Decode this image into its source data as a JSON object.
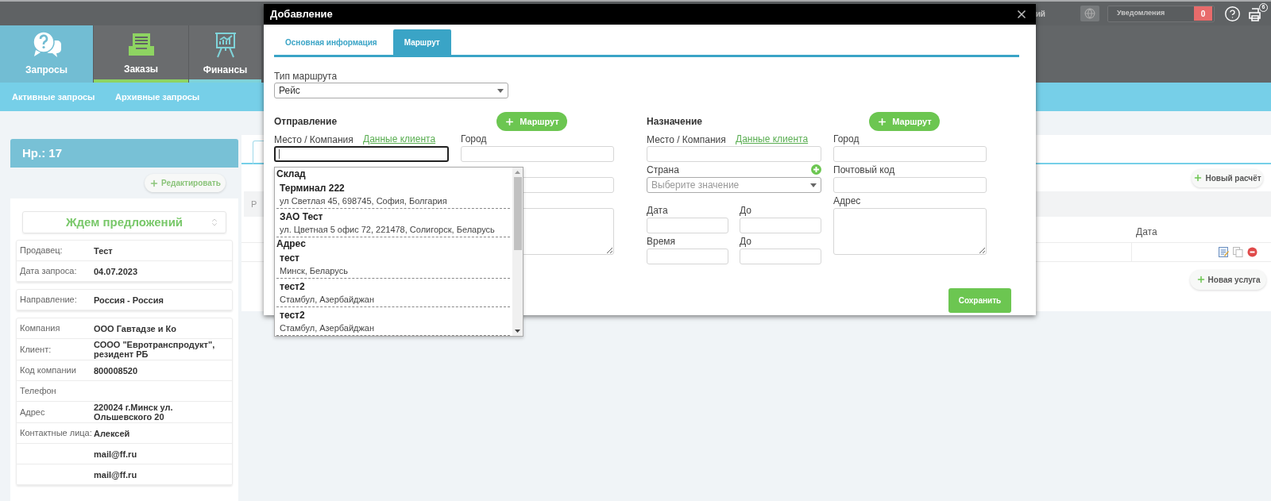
{
  "top_bar": {
    "user_fragment": "ий",
    "notifications_label": "Уведомления",
    "notifications_count": "0",
    "print_badge": "6"
  },
  "nav": [
    {
      "label": "Запросы",
      "selected": true,
      "color": "#72bdd3"
    },
    {
      "label": "Заказы",
      "selected": false,
      "color": "#8ed462"
    },
    {
      "label": "Финансы",
      "selected": false,
      "color": "#7fd3d9"
    }
  ],
  "subnav": [
    "Активные запросы",
    "Архивные запросы"
  ],
  "request": {
    "title": "Нр.: 17",
    "edit_button": "Редактировать",
    "status": "Ждем предложений",
    "groups": [
      [
        {
          "label": "Продавец:",
          "value": "Тест"
        },
        {
          "label": "Дата запроса:",
          "value": "04.07.2023"
        }
      ],
      [
        {
          "label": "Направление:",
          "value": "Россия - Россия"
        }
      ],
      [
        {
          "label": "Компания",
          "value": "ООО Гавтадзе и Ко"
        },
        {
          "label": "Клиент:",
          "value": "СООО \"Евротранспродукт\", резидент РБ"
        },
        {
          "label": "Код компании",
          "value": "800008520"
        },
        {
          "label": "Телефон"
        },
        {
          "label": "Адрес",
          "value": "220024 г.Минск ул. Ольшевского 20"
        },
        {
          "label": "Контактные лица:",
          "value": "Алексей"
        },
        {
          "value": "mail@ff.ru"
        },
        {
          "value": "mail@ff.ru"
        }
      ]
    ]
  },
  "main": {
    "new_calc_button": "Новый расчёт",
    "row_fragment": "Р",
    "date_column": "Дата",
    "new_service_button": "Новая услуга"
  },
  "modal": {
    "title": "Добавление",
    "tabs": [
      {
        "label": "Основная информация",
        "selected": false
      },
      {
        "label": "Маршрут",
        "selected": true
      }
    ],
    "route_type_label": "Тип маршрута",
    "route_type_value": "Рейс",
    "origin": {
      "heading": "Отправление",
      "route_button": "Маршрут",
      "place_label": "Место / Компания",
      "client_link": "Данные клиента",
      "place_focused": true,
      "city_label": "Город"
    },
    "destination": {
      "heading": "Назначение",
      "route_button": "Маршрут",
      "place_label": "Место / Компания",
      "client_link": "Данные клиента",
      "place_focused": false,
      "city_label": "Город",
      "country_label": "Страна",
      "country_placeholder": "Выберите значение",
      "postal_label": "Почтовый код",
      "date_label": "Дата",
      "date_to_label": "До",
      "time_label": "Время",
      "time_to_label": "До",
      "address_label": "Адрес"
    },
    "suggestions": [
      {
        "heading": "Склад",
        "items": [
          {
            "name": "Терминал 222",
            "address": "ул Светлая 45, 698745, София, Болгария"
          },
          {
            "name": "ЗАО Тест",
            "address": "ул. Цветная 5 офис 72, 221478, Солигорск, Беларусь"
          }
        ]
      },
      {
        "heading": "Адрес",
        "items": [
          {
            "name": "тест",
            "address": "Минск, Беларусь"
          },
          {
            "name": "тест2",
            "address": "Стамбул, Азербайджан"
          },
          {
            "name": "тест2",
            "address": "Стамбул, Азербайджан"
          }
        ]
      }
    ],
    "save_button": "Сохранить"
  }
}
